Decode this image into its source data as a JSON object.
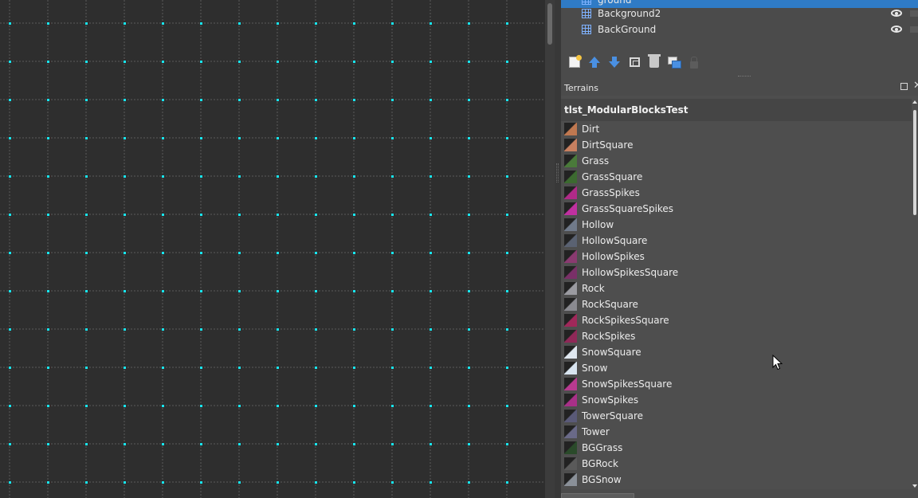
{
  "layers": {
    "items": [
      {
        "name": "ground",
        "visible": true,
        "selected": true
      },
      {
        "name": "Background2",
        "visible": true,
        "selected": false
      },
      {
        "name": "BackGround",
        "visible": true,
        "selected": false
      }
    ]
  },
  "layer_toolbar": {
    "buttons": [
      "new-layer-icon",
      "raise-layer-icon",
      "lower-layer-icon",
      "duplicate-layer-icon",
      "delete-layer-icon",
      "layer-stack-icon",
      "lock-icon"
    ]
  },
  "terrains_panel": {
    "title": "Terrains",
    "tileset_name": "tlst_ModularBlocksTest",
    "items": [
      {
        "label": "Dirt",
        "color": "#c07850"
      },
      {
        "label": "DirtSquare",
        "color": "#c88060"
      },
      {
        "label": "Grass",
        "color": "#4a7a3a"
      },
      {
        "label": "GrassSquare",
        "color": "#3c6a30"
      },
      {
        "label": "GrassSpikes",
        "color": "#b02a88"
      },
      {
        "label": "GrassSquareSpikes",
        "color": "#c030a0"
      },
      {
        "label": "Hollow",
        "color": "#707a8a"
      },
      {
        "label": "HollowSquare",
        "color": "#5a6272"
      },
      {
        "label": "HollowSpikes",
        "color": "#8a3a70"
      },
      {
        "label": "HollowSpikesSquare",
        "color": "#7a3068"
      },
      {
        "label": "Rock",
        "color": "#9a9aa0"
      },
      {
        "label": "RockSquare",
        "color": "#8a8a90"
      },
      {
        "label": "RockSpikesSquare",
        "color": "#a0285a"
      },
      {
        "label": "RockSpikes",
        "color": "#902858"
      },
      {
        "label": "SnowSquare",
        "color": "#e0e8f0"
      },
      {
        "label": "Snow",
        "color": "#d8e4f0"
      },
      {
        "label": "SnowSpikesSquare",
        "color": "#b83a90"
      },
      {
        "label": "SnowSpikes",
        "color": "#a83088"
      },
      {
        "label": "TowerSquare",
        "color": "#5a5a78"
      },
      {
        "label": "Tower",
        "color": "#6a6a88"
      },
      {
        "label": "BGGrass",
        "color": "#2a4a2a"
      },
      {
        "label": "BGRock",
        "color": "#5a5a5a"
      },
      {
        "label": "BGSnow",
        "color": "#8a9098"
      }
    ]
  },
  "canvas": {
    "grid_line_color": "#5a5a5a",
    "grid_dot_color": "#19e6f0"
  }
}
